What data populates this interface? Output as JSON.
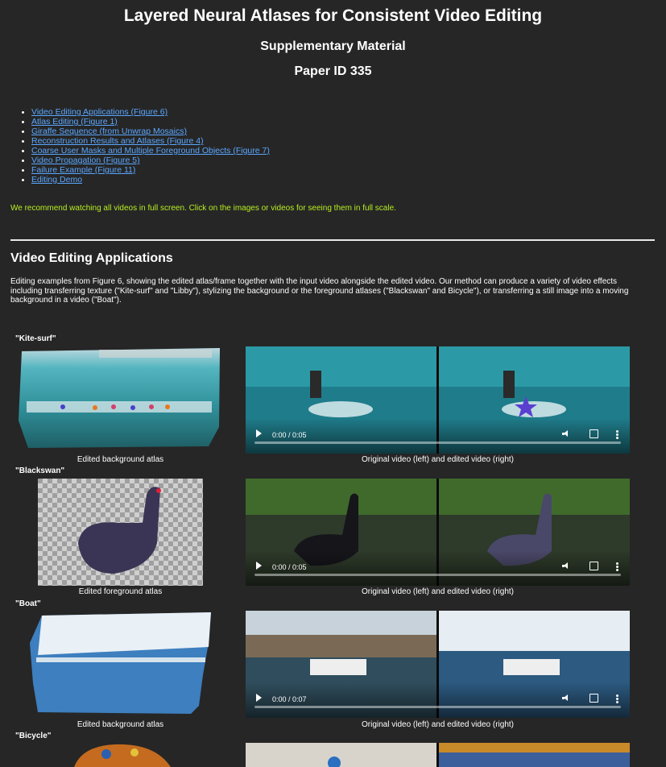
{
  "header": {
    "title": "Layered Neural Atlases for Consistent Video Editing",
    "subtitle": "Supplementary Material",
    "paper_id": "Paper ID 335"
  },
  "toc": [
    "Video Editing Applications (Figure 6)",
    "Atlas Editing (Figure 1)",
    "Giraffe Sequence (from Unwrap Mosaics)",
    "Reconstruction Results and Atlases (Figure 4)",
    "Coarse User Masks and Multiple Foreground Objects (Figure 7)",
    "Video Propagation (Figure 5)",
    "Failure Example (Figure 11)",
    "Editing Demo"
  ],
  "recommendation": "We recommend watching all videos in full screen. Click on the images or videos for seeing them in full scale.",
  "section": {
    "title": "Video Editing Applications",
    "description": "Editing examples from Figure 6, showing the edited atlas/frame together with the input video alongside the edited video. Our method can produce a variety of video effects including transferring texture (\"Kite-surf\" and \"Libby\"), stylizing the background or the foreground atlases (\"Blackswan\" and Bicycle\"), or transferring a still image into a moving background in a video (\"Boat\")."
  },
  "examples": [
    {
      "label": "\"Kite-surf\"",
      "atlas_caption": "Edited background atlas",
      "video_caption": "Original video (left) and edited video (right)",
      "time": "0:00 / 0:05",
      "progress": 0
    },
    {
      "label": "\"Blackswan\"",
      "atlas_caption": "Edited foreground atlas",
      "video_caption": "Original video (left) and edited video (right)",
      "time": "0:00 / 0:05",
      "progress": 0
    },
    {
      "label": "\"Boat\"",
      "atlas_caption": "Edited background atlas",
      "video_caption": "Original video (left) and edited video (right)",
      "time": "0:00 / 0:07",
      "progress": 0
    },
    {
      "label": "\"Bicycle\""
    }
  ],
  "colors": {
    "background": "#262626",
    "link": "#5aa7ff",
    "recommendation": "#b8f020"
  }
}
